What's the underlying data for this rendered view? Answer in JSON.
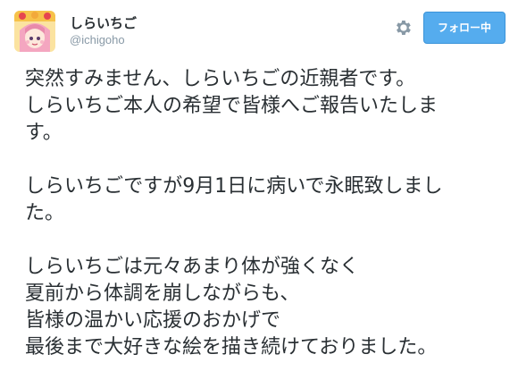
{
  "header": {
    "display_name": "しらいちご",
    "screen_name": "@ichigoho",
    "follow_label": "フォロー中"
  },
  "icons": {
    "avatar": "avatar-illustration",
    "settings": "gear-icon"
  },
  "colors": {
    "follow_button": "#55acee",
    "text": "#292f33",
    "muted": "#8899a6"
  },
  "tweet": {
    "paragraphs": [
      {
        "lines": [
          "突然すみません、しらいちごの近親者です。",
          "しらいちご本人の希望で皆様へご報告いたしま",
          "す。"
        ]
      },
      {
        "lines": [
          "しらいちごですが9月1日に病いで永眠致しまし",
          "た。"
        ]
      },
      {
        "lines": [
          "しらいちごは元々あまり体が強くなく",
          "夏前から体調を崩しながらも、",
          "皆様の温かい応援のおかげで",
          "最後まで大好きな絵を描き続けておりました。"
        ]
      }
    ]
  }
}
